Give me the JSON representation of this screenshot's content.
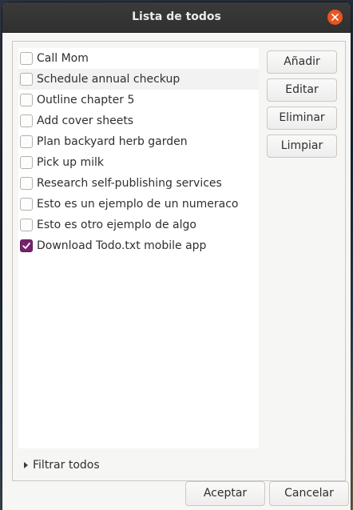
{
  "window": {
    "title": "Lista de todos"
  },
  "todos": [
    {
      "label": "Call Mom",
      "checked": false
    },
    {
      "label": "Schedule annual checkup",
      "checked": false
    },
    {
      "label": "Outline chapter 5",
      "checked": false
    },
    {
      "label": "Add cover sheets",
      "checked": false
    },
    {
      "label": "Plan backyard herb garden",
      "checked": false
    },
    {
      "label": "Pick up milk",
      "checked": false
    },
    {
      "label": "Research self-publishing services",
      "checked": false
    },
    {
      "label": "Esto es un ejemplo de un numeraco",
      "checked": false
    },
    {
      "label": "Esto es otro ejemplo de algo",
      "checked": false
    },
    {
      "label": "Download Todo.txt mobile app",
      "checked": true
    }
  ],
  "actions": {
    "add": "Añadir",
    "edit": "Editar",
    "delete": "Eliminar",
    "clear": "Limpiar"
  },
  "filter": {
    "label": "Filtrar todos"
  },
  "dialog": {
    "accept": "Aceptar",
    "cancel": "Cancelar"
  },
  "colors": {
    "accent": "#77216f",
    "close_button": "#e9541f",
    "titlebar": "#333333"
  }
}
